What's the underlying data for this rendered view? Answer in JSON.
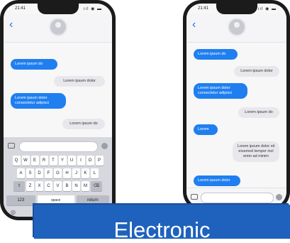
{
  "status": {
    "time": "21:41",
    "icons": "ııl ◉ ▬"
  },
  "left_phone": {
    "messages": [
      {
        "type": "sent",
        "text": "Lorem ipsum do"
      },
      {
        "type": "received",
        "text": "Lorem ipsum dolor"
      },
      {
        "type": "sent",
        "text": "Lorem ipsum dolor consectetur adipisci"
      },
      {
        "type": "received",
        "text": "Lorem ipsum do"
      }
    ],
    "keyboard": {
      "row1": [
        "Q",
        "W",
        "E",
        "R",
        "T",
        "Y",
        "U",
        "I",
        "O",
        "P"
      ],
      "row2": [
        "A",
        "S",
        "D",
        "F",
        "G",
        "H",
        "J",
        "K",
        "L"
      ],
      "row3": [
        "⇧",
        "Z",
        "X",
        "C",
        "V",
        "B",
        "N",
        "M",
        "⌫"
      ],
      "key_123": "123",
      "key_space": "space",
      "key_return": "return"
    }
  },
  "right_phone": {
    "messages": [
      {
        "type": "sent",
        "text": "Lorem ipsum do"
      },
      {
        "type": "received",
        "text": "Lorem ipsum dolor"
      },
      {
        "type": "sent",
        "text": "Lorem ipsum dolor consectetur adipisci"
      },
      {
        "type": "received",
        "text": "Lorem ipsum do"
      },
      {
        "type": "sent",
        "text": "Lorem"
      },
      {
        "type": "received",
        "text": "Lorem ipsum dolor sit eiusmod tempor incl enim ad minim"
      },
      {
        "type": "sent",
        "text": "Lorem ipsum dolor"
      }
    ]
  },
  "banner": {
    "text": "Electronic"
  },
  "colors": {
    "sent_bubble": "#1f7ff0",
    "received_bubble": "#e8e8ec",
    "banner": "#1f62bd"
  }
}
